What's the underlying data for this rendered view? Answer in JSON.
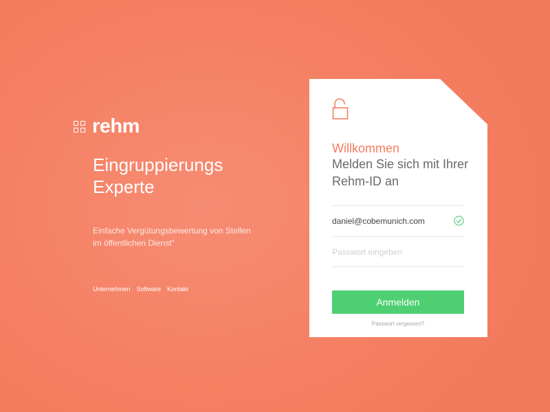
{
  "brand": {
    "logo_text": "rehm",
    "logo_icon": "grid-four-squares-icon"
  },
  "hero": {
    "headline_line1": "Eingruppierungs",
    "headline_line2": "Experte",
    "tagline": "Einfache Vergütungsbewertung von Stellen im öffentlichen Dienst\""
  },
  "footer": {
    "links": [
      "Unternehmen",
      "Software",
      "Kontakt"
    ]
  },
  "login": {
    "icon": "unlocked-padlock-icon",
    "welcome": "Willkommen",
    "subtitle": "Melden Sie sich mit Ihrer Rehm-ID an",
    "email_value": "daniel@cobemunich.com",
    "email_valid_icon": "check-circle-icon",
    "password_value": "",
    "password_placeholder": "Passwort eingeben",
    "submit_label": "Anmelden",
    "forgot_label": "Passwort vergessen?"
  },
  "colors": {
    "background": "#f58063",
    "accent": "#f47e62",
    "submit": "#4dcf72",
    "card": "#ffffff"
  }
}
